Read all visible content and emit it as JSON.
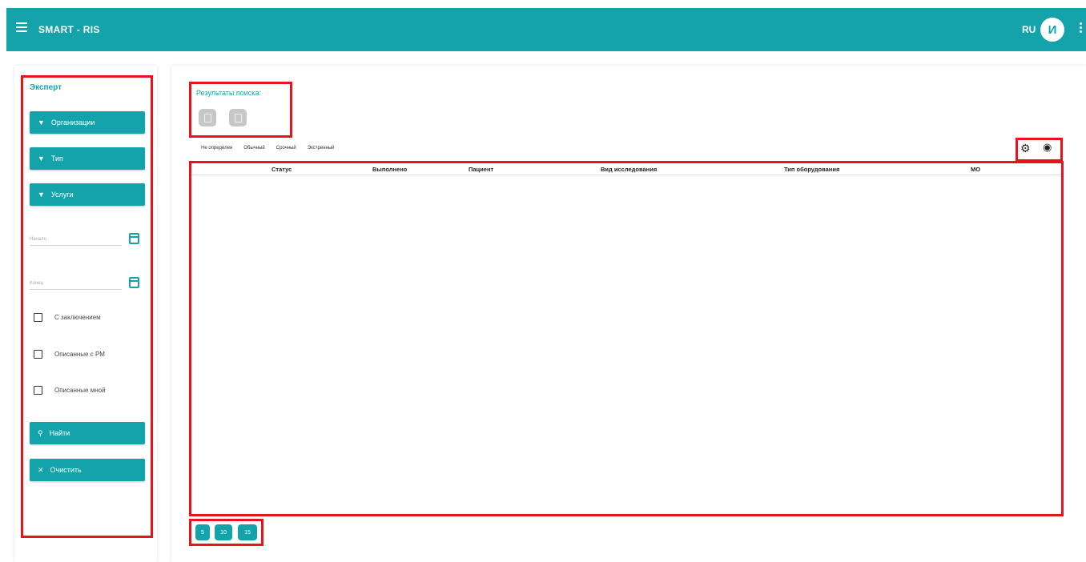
{
  "appbar": {
    "title": "SMART - RIS",
    "language": "RU",
    "avatar_initial": "И"
  },
  "filters": {
    "title": "Эксперт",
    "organizations_label": "Организации",
    "type_label": "Тип",
    "services_label": "Услуги",
    "date_from_placeholder": "Начало",
    "date_to_placeholder": "Конец",
    "checkboxes": [
      {
        "label": "С заключением",
        "checked": false
      },
      {
        "label": "Описанные с РМ",
        "checked": false
      },
      {
        "label": "Описанные мной",
        "checked": false
      }
    ],
    "search_label": "Найти",
    "clear_label": "Очистить"
  },
  "main": {
    "results_title": "Результаты поиска:",
    "urgency_tabs": [
      "Не определен",
      "Обычный",
      "Срочный",
      "Экстренный"
    ],
    "table_columns": [
      "Статус",
      "Выполнено",
      "Пациент",
      "Вид исследования",
      "Тип оборудования",
      "МО"
    ],
    "page_sizes": [
      "5",
      "10",
      "15"
    ]
  },
  "colors": {
    "accent": "#14a3ab",
    "highlight": "#e8131d"
  }
}
